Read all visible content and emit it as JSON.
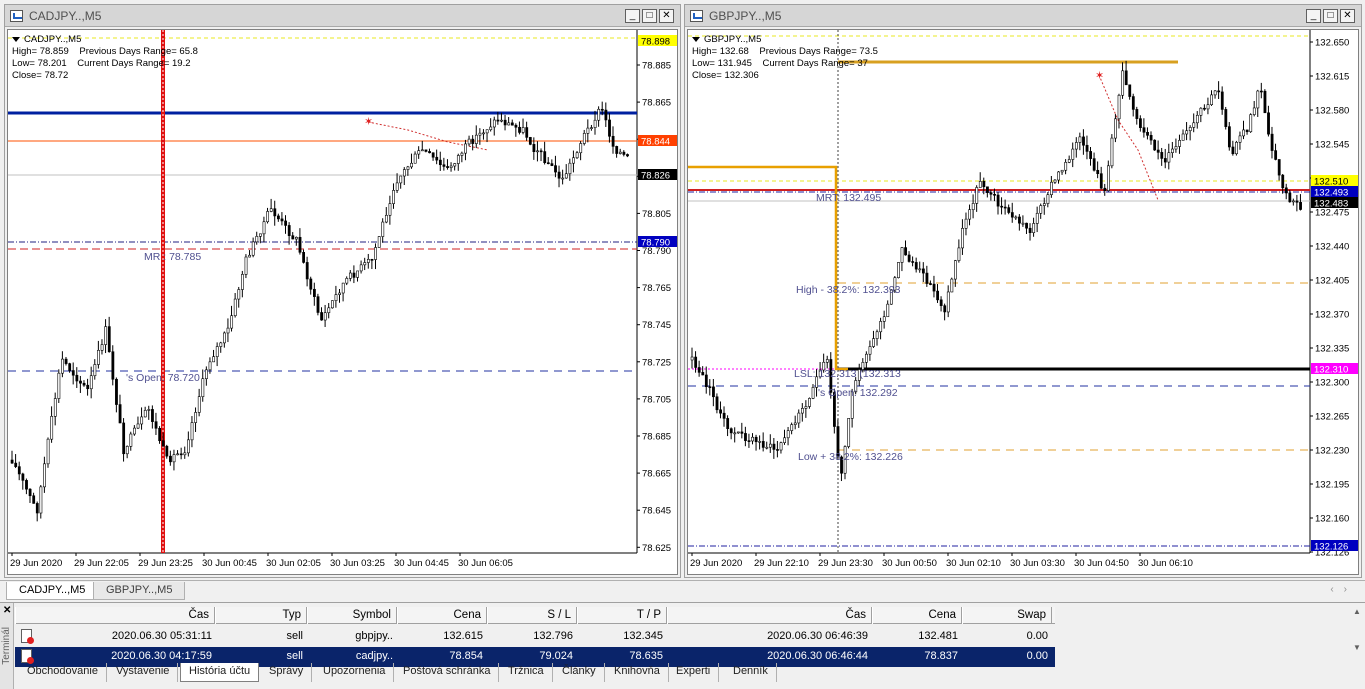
{
  "charts": [
    {
      "id": "cadjpy",
      "title": "CADJPY..,M5",
      "info": {
        "symbol_label": "CADJPY..,M5",
        "high": "High= 78.859",
        "low": "Low= 78.201",
        "close": "Close= 78.72",
        "prev_range": "Previous Days Range= 65.8",
        "curr_range": "Current Days Range= 19.2"
      },
      "price_ticks": [
        "78.885",
        "78.865",
        "78.844",
        "78.826",
        "78.805",
        "78.790",
        "78.765",
        "78.745",
        "78.725",
        "78.705",
        "78.685",
        "78.665",
        "78.645",
        "78.625"
      ],
      "price_labels": [
        {
          "text": "78.898",
          "bg": "#ffff00",
          "fg": "#000000"
        },
        {
          "text": "78.844",
          "bg": "#ff4000",
          "fg": "#ffffff"
        },
        {
          "text": "78.826",
          "bg": "#000000",
          "fg": "#ffffff"
        },
        {
          "text": "78.790",
          "bg": "#0000c0",
          "fg": "#ffffff"
        }
      ],
      "annotations": [
        "MR : 78.785",
        "'s Open: 78.720"
      ],
      "time_ticks": [
        "29 Jun 2020",
        "29 Jun 22:05",
        "29 Jun 23:25",
        "30 Jun 00:45",
        "30 Jun 02:05",
        "30 Jun 03:25",
        "30 Jun 04:45",
        "30 Jun 06:05"
      ]
    },
    {
      "id": "gbpjpy",
      "title": "GBPJPY..,M5",
      "info": {
        "symbol_label": "GBPJPY..,M5",
        "high": "High= 132.68",
        "low": "Low= 131.945",
        "close": "Close= 132.306",
        "prev_range": "Previous Days Range= 73.5",
        "curr_range": "Current Days Range= 37"
      },
      "price_ticks": [
        "132.650",
        "132.615",
        "132.580",
        "132.545",
        "132.510",
        "132.475",
        "132.440",
        "132.405",
        "132.370",
        "132.335",
        "132.300",
        "132.265",
        "132.230",
        "132.195",
        "132.160",
        "132.126"
      ],
      "price_labels": [
        {
          "text": "132.510",
          "bg": "#ffff00",
          "fg": "#000000"
        },
        {
          "text": "132.493",
          "bg": "#0000c0",
          "fg": "#ffffff"
        },
        {
          "text": "132.483",
          "bg": "#000000",
          "fg": "#ffffff"
        },
        {
          "text": "132.310",
          "bg": "#ff00ff",
          "fg": "#ffffff"
        },
        {
          "text": "132.126",
          "bg": "#0000c0",
          "fg": "#ffffff"
        }
      ],
      "annotations": [
        "MRT: 132.495",
        "High - 38.2%: 132.393",
        "LSL: 132.313 (132.313",
        "'s Open: 132.292",
        "Low + 38.2%: 132.226"
      ],
      "time_ticks": [
        "29 Jun 2020",
        "29 Jun 22:10",
        "29 Jun 23:30",
        "30 Jun 00:50",
        "30 Jun 02:10",
        "30 Jun 03:30",
        "30 Jun 04:50",
        "30 Jun 06:10"
      ]
    }
  ],
  "chart_tabs": [
    "CADJPY..,M5",
    "GBPJPY..,M5"
  ],
  "terminal": {
    "label": "Terminál",
    "columns": [
      "Čas",
      "Typ",
      "Symbol",
      "Cena",
      "S / L",
      "T / P",
      "Čas",
      "Cena",
      "Swap"
    ],
    "rows": [
      {
        "open_time": "2020.06.30 05:31:11",
        "type": "sell",
        "symbol": "gbpjpy..",
        "price": "132.615",
        "sl": "132.796",
        "tp": "132.345",
        "close_time": "2020.06.30 06:46:39",
        "close_price": "132.481",
        "swap": "0.00"
      },
      {
        "open_time": "2020.06.30 04:17:59",
        "type": "sell",
        "symbol": "cadjpy..",
        "price": "78.854",
        "sl": "79.024",
        "tp": "78.635",
        "close_time": "2020.06.30 06:46:44",
        "close_price": "78.837",
        "swap": "0.00"
      }
    ],
    "tabs": [
      "Obchodovanie",
      "Vystavenie",
      "História účtu",
      "Správy",
      "Upozornenia",
      "Poštová schránka",
      "Tržnica",
      "Články",
      "Knihovňa",
      "Experti",
      "Denník"
    ]
  }
}
